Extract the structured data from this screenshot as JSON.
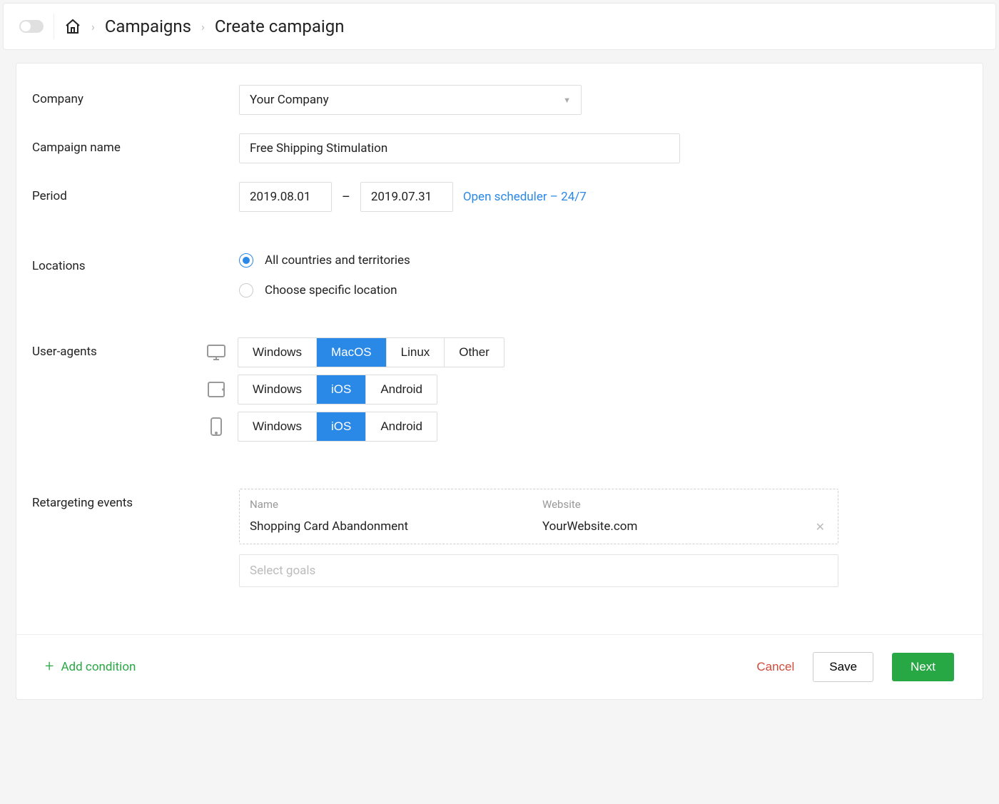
{
  "breadcrumb": {
    "campaigns": "Campaigns",
    "current": "Create campaign"
  },
  "form": {
    "company": {
      "label": "Company",
      "value": "Your Company"
    },
    "campaign_name": {
      "label": "Campaign name",
      "value": "Free Shipping Stimulation"
    },
    "period": {
      "label": "Period",
      "start": "2019.08.01",
      "end": "2019.07.31",
      "scheduler_link": "Open scheduler – 24/7"
    },
    "locations": {
      "label": "Locations",
      "option_all": "All countries and territories",
      "option_specific": "Choose specific location"
    },
    "user_agents": {
      "label": "User-agents",
      "desktop": {
        "options": [
          "Windows",
          "MacOS",
          "Linux",
          "Other"
        ],
        "selected": "MacOS"
      },
      "tablet": {
        "options": [
          "Windows",
          "iOS",
          "Android"
        ],
        "selected": "iOS"
      },
      "mobile": {
        "options": [
          "Windows",
          "iOS",
          "Android"
        ],
        "selected": "iOS"
      }
    },
    "retargeting": {
      "label": "Retargeting events",
      "col_name": "Name",
      "col_website": "Website",
      "row_name": "Shopping Card Abandonment",
      "row_website": "YourWebsite.com",
      "select_placeholder": "Select goals"
    }
  },
  "footer": {
    "add_condition": "Add condition",
    "cancel": "Cancel",
    "save": "Save",
    "next": "Next"
  }
}
